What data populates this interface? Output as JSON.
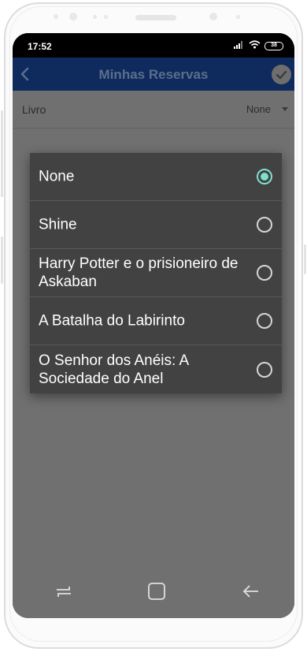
{
  "status_bar": {
    "time": "17:52",
    "battery": "38"
  },
  "app_bar": {
    "title": "Minhas Reservas"
  },
  "form": {
    "field_label": "Livro",
    "selected_value": "None"
  },
  "dialog": {
    "selected_index": 0,
    "options": [
      {
        "label": "None",
        "checked": true
      },
      {
        "label": "Shine",
        "checked": false
      },
      {
        "label": "Harry Potter e o prisioneiro de Askaban",
        "checked": false
      },
      {
        "label": "A Batalha do Labirinto",
        "checked": false
      },
      {
        "label": "O Senhor dos Anéis: A Sociedade do Anel",
        "checked": false
      }
    ]
  },
  "colors": {
    "app_bar": "#0f2b5d",
    "scrim_background": "#707070",
    "dialog_background": "#424242",
    "radio_accent": "#7fe0cf"
  },
  "icons": {
    "back": "back-arrow-icon",
    "confirm": "check-circle-icon",
    "nav_recents": "recents-icon",
    "nav_home": "home-icon",
    "nav_back": "nav-back-icon"
  }
}
